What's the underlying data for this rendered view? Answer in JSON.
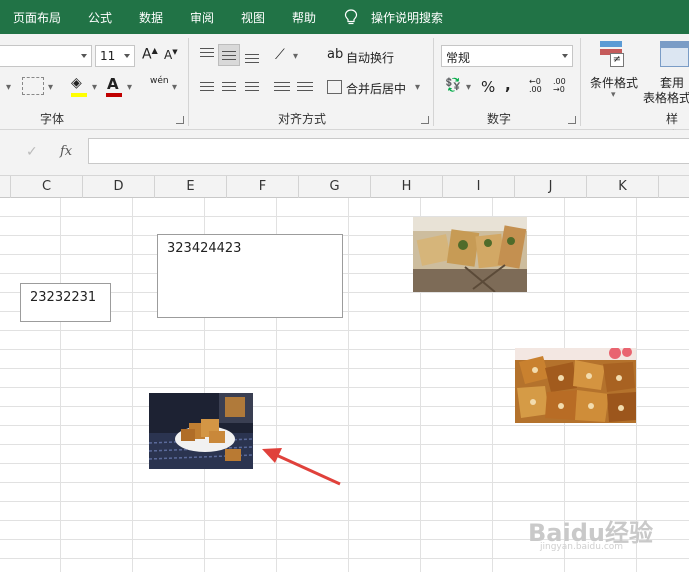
{
  "tabs": [
    "页面布局",
    "公式",
    "数据",
    "审阅",
    "视图",
    "帮助"
  ],
  "tell_me": "操作说明搜索",
  "ribbon": {
    "font_size": "11",
    "wrap_text": "自动换行",
    "merge_center": "合并后居中",
    "number_format": "常规",
    "percent": "%",
    "comma": ",",
    "conditional_format": "条件格式",
    "table_format_line1": "套用",
    "table_format_line2": "表格格式",
    "group_font": "字体",
    "group_alignment": "对齐方式",
    "group_number": "数字",
    "group_styles": "样式",
    "phonetic": "wén"
  },
  "formula_bar": {
    "fx": "fx",
    "check": "✓",
    "content": ""
  },
  "columns": [
    "C",
    "D",
    "E",
    "F",
    "G",
    "H",
    "I",
    "J",
    "K"
  ],
  "textboxes": [
    "23232231",
    "323424423"
  ],
  "watermark": {
    "main": "Baidu经验",
    "sub": "jingyan.baidu.com"
  },
  "colors": {
    "tab_green": "#217346",
    "font_red": "#c00000",
    "highlight_yellow": "#ffff00",
    "arrow": "#e0413b"
  }
}
